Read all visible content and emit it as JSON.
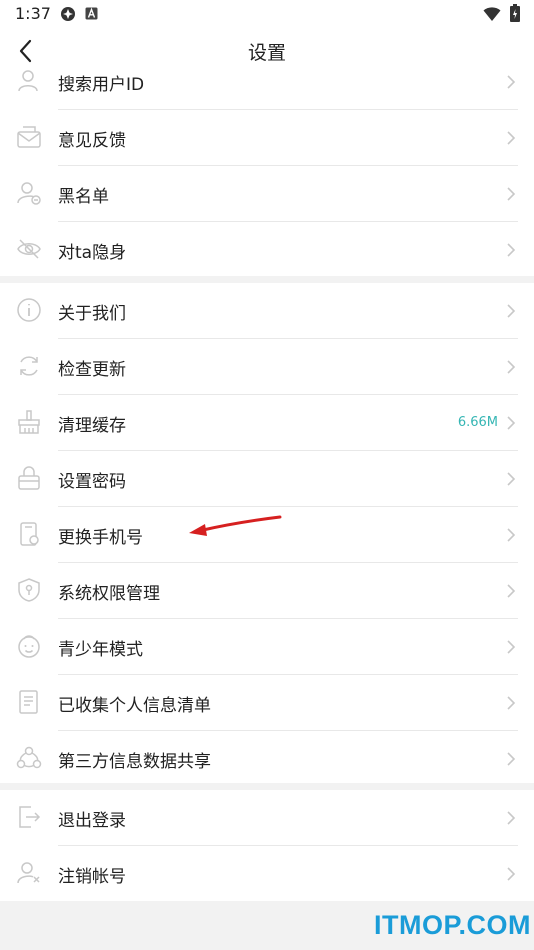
{
  "status_bar": {
    "time": "1:37"
  },
  "header": {
    "title": "设置"
  },
  "sections": [
    {
      "items": [
        {
          "label": "搜索用户ID",
          "icon": "search-user-icon"
        },
        {
          "label": "意见反馈",
          "icon": "feedback-icon"
        },
        {
          "label": "黑名单",
          "icon": "blacklist-icon"
        },
        {
          "label": "对ta隐身",
          "icon": "invisible-icon"
        }
      ]
    },
    {
      "items": [
        {
          "label": "关于我们",
          "icon": "info-icon"
        },
        {
          "label": "检查更新",
          "icon": "refresh-icon"
        },
        {
          "label": "清理缓存",
          "icon": "broom-icon",
          "value": "6.66M"
        },
        {
          "label": "设置密码",
          "icon": "lock-icon"
        },
        {
          "label": "更换手机号",
          "icon": "phone-icon"
        },
        {
          "label": "系统权限管理",
          "icon": "shield-icon"
        },
        {
          "label": "青少年模式",
          "icon": "child-icon"
        },
        {
          "label": "已收集个人信息清单",
          "icon": "document-icon"
        },
        {
          "label": "第三方信息数据共享",
          "icon": "share-icon"
        }
      ]
    },
    {
      "items": [
        {
          "label": "退出登录",
          "icon": "logout-icon"
        },
        {
          "label": "注销帐号",
          "icon": "delete-account-icon"
        }
      ]
    }
  ],
  "watermark": "ITMOP.COM",
  "colors": {
    "accent_value": "#36b6b4",
    "annotation_arrow": "#d62020",
    "watermark": "#1a9cd8"
  }
}
